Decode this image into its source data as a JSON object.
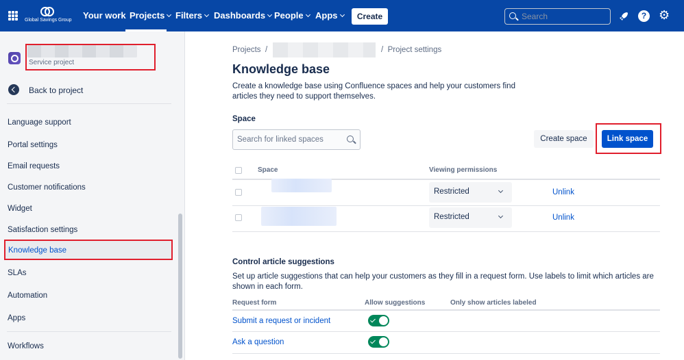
{
  "topnav": {
    "logo_text": "Global Savings Group",
    "items": [
      {
        "label": "Your work",
        "dropdown": false
      },
      {
        "label": "Projects",
        "dropdown": true
      },
      {
        "label": "Filters",
        "dropdown": true
      },
      {
        "label": "Dashboards",
        "dropdown": true
      },
      {
        "label": "People",
        "dropdown": true
      },
      {
        "label": "Apps",
        "dropdown": true
      }
    ],
    "active_item": "Projects",
    "create_label": "Create",
    "search_placeholder": "Search",
    "icons": [
      "apps-grid-icon",
      "rocket-icon",
      "help-icon",
      "gear-icon"
    ],
    "colors": {
      "nav_bg": "#0747a6",
      "accent": "#0052cc",
      "highlight": "#e01e2c"
    }
  },
  "sidebar": {
    "project_type": "Service project",
    "back_label": "Back to project",
    "items": [
      {
        "label": "Language support"
      },
      {
        "label": "Portal settings"
      },
      {
        "label": "Email requests"
      },
      {
        "label": "Customer notifications"
      },
      {
        "label": "Widget"
      },
      {
        "label": "Satisfaction settings"
      },
      {
        "label": "Knowledge base",
        "active": true
      },
      {
        "label": "SLAs"
      },
      {
        "label": "Automation"
      },
      {
        "label": "Apps"
      },
      {
        "label": "Workflows"
      }
    ]
  },
  "main": {
    "breadcrumb": {
      "first": "Projects",
      "separator": "/",
      "last": "Project settings"
    },
    "title": "Knowledge base",
    "description": "Create a knowledge base using Confluence spaces and help your customers find articles they need to support themselves.",
    "space_section": {
      "heading": "Space",
      "search_placeholder": "Search for linked spaces",
      "create_space_label": "Create space",
      "link_space_label": "Link space",
      "columns": [
        "Space",
        "Viewing permissions"
      ],
      "rows": [
        {
          "permission": "Restricted",
          "action": "Unlink"
        },
        {
          "permission": "Restricted",
          "action": "Unlink"
        }
      ]
    },
    "suggestions_section": {
      "heading": "Control article suggestions",
      "description": "Set up article suggestions that can help your customers as they fill in a request form. Use labels to limit which articles are shown in each form.",
      "columns": [
        "Request form",
        "Allow suggestions",
        "Only show articles labeled"
      ],
      "rows": [
        {
          "form": "Submit a request or incident",
          "allow": true
        },
        {
          "form": "Ask a question",
          "allow": true
        }
      ]
    }
  }
}
